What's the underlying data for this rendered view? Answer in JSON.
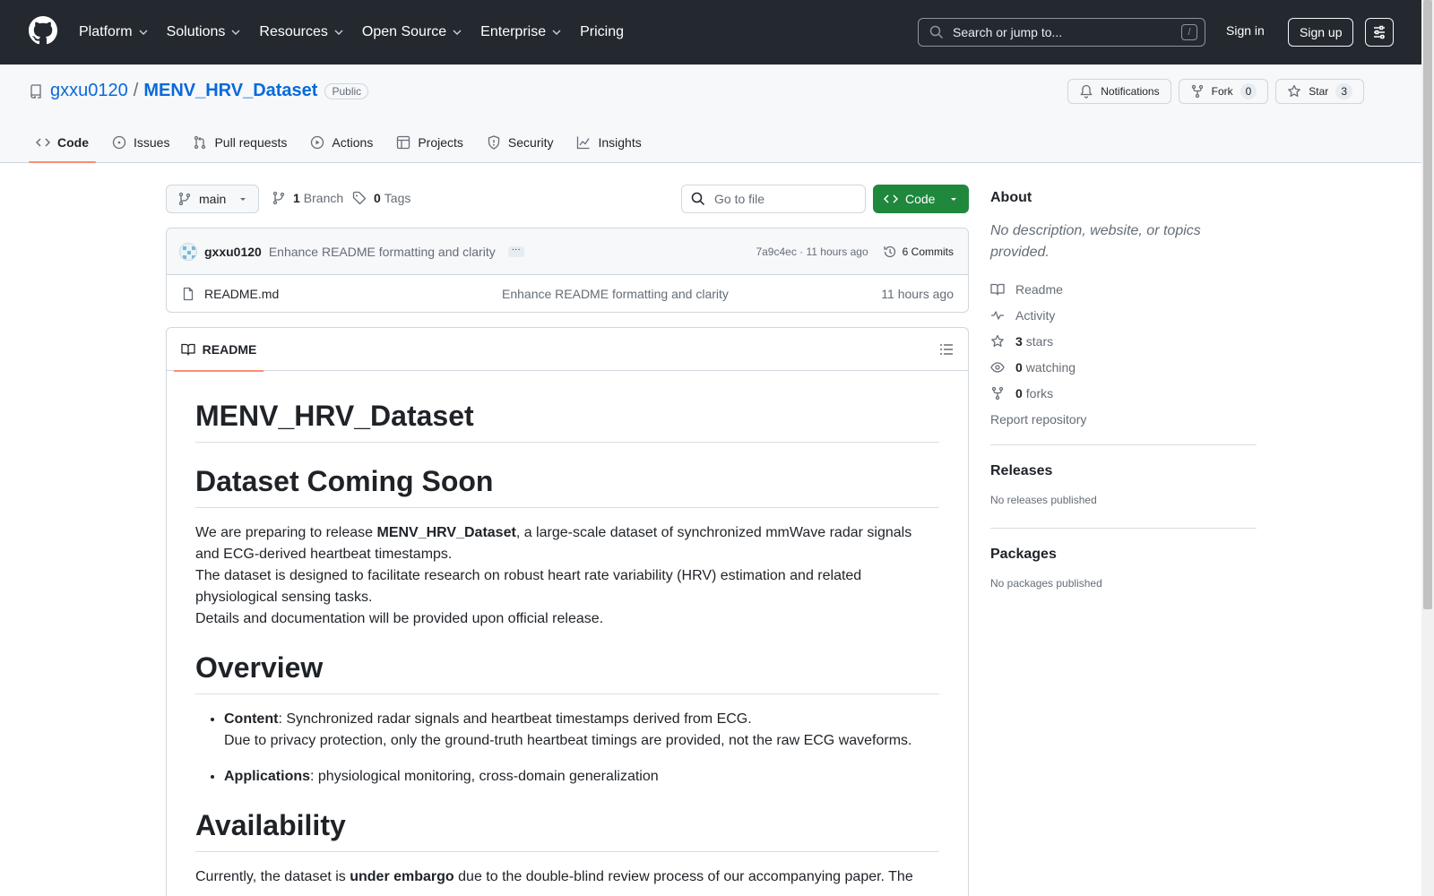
{
  "header": {
    "nav": [
      {
        "label": "Platform",
        "has_menu": true
      },
      {
        "label": "Solutions",
        "has_menu": true
      },
      {
        "label": "Resources",
        "has_menu": true
      },
      {
        "label": "Open Source",
        "has_menu": true
      },
      {
        "label": "Enterprise",
        "has_menu": true
      },
      {
        "label": "Pricing",
        "has_menu": false
      }
    ],
    "search_placeholder": "Search or jump to...",
    "search_shortcut": "/",
    "signin": "Sign in",
    "signup": "Sign up"
  },
  "repo": {
    "owner": "gxxu0120",
    "separator": "/",
    "name": "MENV_HRV_Dataset",
    "visibility": "Public",
    "notifications_label": "Notifications",
    "fork_label": "Fork",
    "fork_count": "0",
    "star_label": "Star",
    "star_count": "3",
    "tabs": [
      {
        "label": "Code",
        "icon": "code-icon",
        "active": true
      },
      {
        "label": "Issues",
        "icon": "issue-icon"
      },
      {
        "label": "Pull requests",
        "icon": "pull-request-icon"
      },
      {
        "label": "Actions",
        "icon": "play-icon"
      },
      {
        "label": "Projects",
        "icon": "table-icon"
      },
      {
        "label": "Security",
        "icon": "shield-icon"
      },
      {
        "label": "Insights",
        "icon": "graph-icon"
      }
    ]
  },
  "toolbar": {
    "branch": "main",
    "branch_count": "1",
    "branch_label": "Branch",
    "tag_count": "0",
    "tag_label": "Tags",
    "goto_file": "Go to file",
    "code_button": "Code"
  },
  "latest_commit": {
    "author": "gxxu0120",
    "message": "Enhance README formatting and clarity",
    "hash_time": "7a9c4ec · 11 hours ago",
    "commits": "6 Commits"
  },
  "files": [
    {
      "name": "README.md",
      "message": "Enhance README formatting and clarity",
      "time": "11 hours ago"
    }
  ],
  "readme": {
    "tab_label": "README",
    "title": "MENV_HRV_Dataset",
    "h_coming": "Dataset Coming Soon",
    "p1_pre": "We are preparing to release ",
    "p1_bold": "MENV_HRV_Dataset",
    "p1_post": ", a large-scale dataset of synchronized mmWave radar signals and ECG-derived heartbeat timestamps.",
    "p1_line2": "The dataset is designed to facilitate research on robust heart rate variability (HRV) estimation and related physiological sensing tasks.",
    "p1_line3": "Details and documentation will be provided upon official release.",
    "h_overview": "Overview",
    "li1_bold": "Content",
    "li1_text": ": Synchronized radar signals and heartbeat timestamps derived from ECG.",
    "li1_line2": "Due to privacy protection, only the ground-truth heartbeat timings are provided, not the raw ECG waveforms.",
    "li2_bold": "Applications",
    "li2_text": ": physiological monitoring, cross-domain generalization",
    "h_availability": "Availability",
    "p_avail_pre": "Currently, the dataset is ",
    "p_avail_bold": "under embargo",
    "p_avail_post": " due to the double-blind review process of our accompanying paper. The"
  },
  "sidebar": {
    "about_title": "About",
    "about_desc": "No description, website, or topics provided.",
    "readme_link": "Readme",
    "activity_link": "Activity",
    "stars_count": "3",
    "stars_label": "stars",
    "watching_count": "0",
    "watching_label": "watching",
    "forks_count": "0",
    "forks_label": "forks",
    "report": "Report repository",
    "releases_title": "Releases",
    "releases_empty": "No releases published",
    "packages_title": "Packages",
    "packages_empty": "No packages published"
  },
  "colors": {
    "header_bg": "#24292f",
    "link": "#0969da",
    "primary_button": "#1f883d",
    "active_tab_underline": "#fd8c73"
  }
}
